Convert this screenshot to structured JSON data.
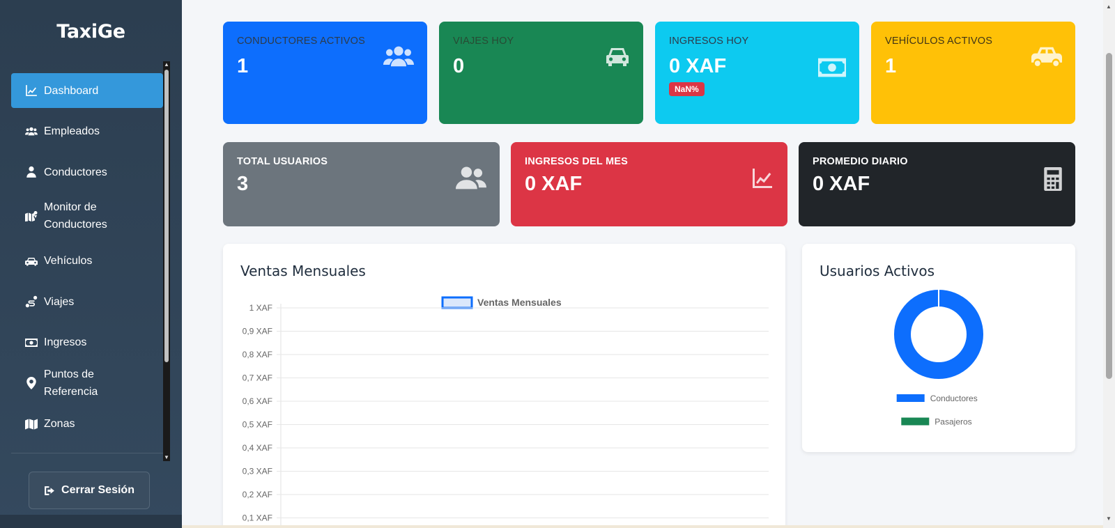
{
  "sidebar": {
    "brand": "TaxiGe",
    "items": [
      {
        "label": "Dashboard",
        "icon": "chart-line-icon",
        "active": true
      },
      {
        "label": "Empleados",
        "icon": "users-icon"
      },
      {
        "label": "Conductores",
        "icon": "user-tie-icon"
      },
      {
        "label": "Monitor de Conductores",
        "icon": "map-marked-icon"
      },
      {
        "label": "Vehículos",
        "icon": "car-icon"
      },
      {
        "label": "Viajes",
        "icon": "route-icon"
      },
      {
        "label": "Ingresos",
        "icon": "money-bill-icon"
      },
      {
        "label": "Puntos de Referencia",
        "icon": "map-marker-icon"
      },
      {
        "label": "Zonas",
        "icon": "map-icon"
      }
    ],
    "logout_label": "Cerrar Sesión"
  },
  "stats": {
    "conductores_activos": {
      "title": "Conductores Activos",
      "value": "1",
      "color": "#0d6efd"
    },
    "viajes_hoy": {
      "title": "Viajes Hoy",
      "value": "0",
      "color": "#198754"
    },
    "ingresos_hoy": {
      "title": "Ingresos Hoy",
      "value": "0 XAF",
      "badge": "NaN%",
      "color": "#0dcaf0"
    },
    "vehiculos_activos": {
      "title": "Vehículos Activos",
      "value": "1",
      "color": "#ffc107"
    },
    "total_usuarios": {
      "title": "TOTAL USUARIOS",
      "value": "3",
      "color": "#6c757d"
    },
    "ingresos_mes": {
      "title": "INGRESOS DEL MES",
      "value": "0 XAF",
      "color": "#dc3545"
    },
    "promedio_diario": {
      "title": "PROMEDIO DIARIO",
      "value": "0 XAF",
      "color": "#212529"
    }
  },
  "ventas": {
    "title": "Ventas Mensuales"
  },
  "usuarios": {
    "title": "Usuarios Activos"
  },
  "chart_data": [
    {
      "type": "line",
      "legend": [
        "Ventas Mensuales"
      ],
      "series": [
        {
          "name": "Ventas Mensuales",
          "values": [],
          "color": "#0d6efd"
        }
      ],
      "y_ticks": [
        "1 XAF",
        "0,9 XAF",
        "0,8 XAF",
        "0,7 XAF",
        "0,6 XAF",
        "0,5 XAF",
        "0,4 XAF",
        "0,3 XAF",
        "0,2 XAF",
        "0,1 XAF"
      ],
      "ylim": [
        0,
        1
      ],
      "grid": true,
      "legend_position": "top"
    },
    {
      "type": "pie",
      "categories": [
        "Conductores",
        "Pasajeros"
      ],
      "values": [
        1,
        0
      ],
      "colors": [
        "#0d6efd",
        "#198754"
      ],
      "legend_position": "bottom"
    }
  ]
}
